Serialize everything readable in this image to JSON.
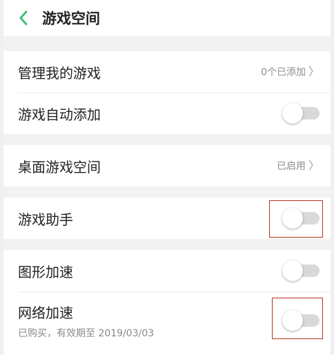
{
  "header": {
    "title": "游戏空间",
    "back_icon": "chevron-left-icon",
    "accent_color": "#3dbf7a"
  },
  "groups": [
    {
      "items": [
        {
          "label": "管理我的游戏",
          "value": "0个已添加"
        },
        {
          "label": "游戏自动添加",
          "toggle_on": false
        }
      ]
    },
    {
      "items": [
        {
          "label": "桌面游戏空间",
          "value": "已启用"
        }
      ]
    },
    {
      "items": [
        {
          "label": "游戏助手",
          "toggle_on": false,
          "highlighted": true
        }
      ]
    },
    {
      "items": [
        {
          "label": "图形加速",
          "toggle_on": false
        },
        {
          "label": "网络加速",
          "sublabel": "已购买，有效期至 2019/03/03",
          "toggle_on": false,
          "highlighted": true
        }
      ]
    }
  ],
  "chevron_glyph": "〉",
  "highlight_color": "#b5301f"
}
